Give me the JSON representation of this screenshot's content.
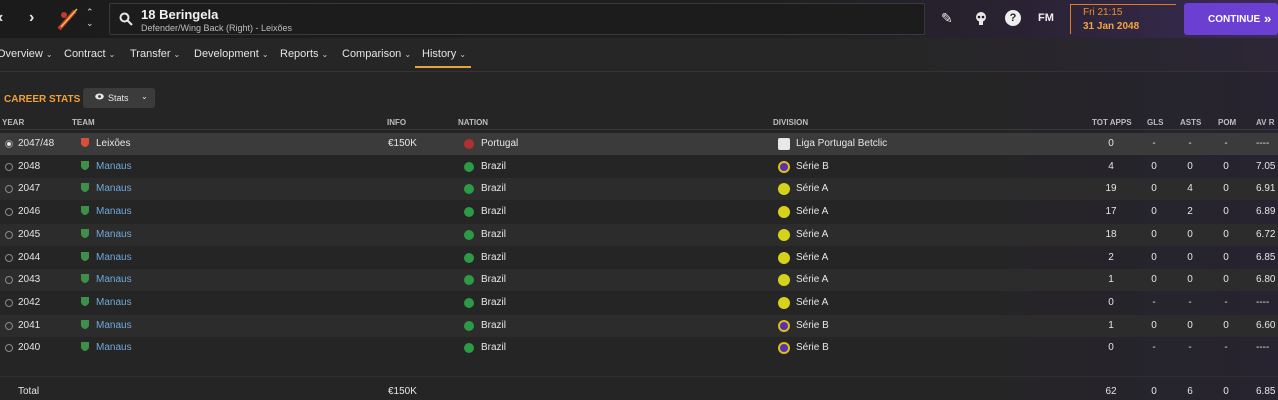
{
  "topbar": {
    "player_name": "18 Beringela",
    "player_subtitle": "Defender/Wing Back (Right) - Leixões",
    "fm_label": "FM",
    "help_label": "?",
    "date_time": "Fri 21:15",
    "date_day": "31 Jan 2048",
    "continue_label": "CONTINUE",
    "continue_arrows": "»"
  },
  "tabs": [
    {
      "label": "Overview"
    },
    {
      "label": "Contract"
    },
    {
      "label": "Transfer"
    },
    {
      "label": "Development"
    },
    {
      "label": "Reports"
    },
    {
      "label": "Comparison"
    },
    {
      "label": "History",
      "active": true
    }
  ],
  "section": {
    "title": "CAREER STATS",
    "stats_button": "Stats"
  },
  "columns": {
    "year": "YEAR",
    "team": "TEAM",
    "info": "INFO",
    "nation": "NATION",
    "division": "DIVISION",
    "tot_apps": "TOT APPS",
    "gls": "GLS",
    "asts": "ASTS",
    "pom": "POM",
    "av_r": "AV R"
  },
  "rows": [
    {
      "year": "2047/48",
      "team": "Leixões",
      "info": "€150K",
      "nation": "Portugal",
      "division": "Liga Portugal Betclic",
      "apps": "0",
      "gls": "-",
      "asts": "-",
      "pom": "-",
      "avr": "----"
    },
    {
      "year": "2048",
      "team": "Manaus",
      "info": "",
      "nation": "Brazil",
      "division": "Série B",
      "apps": "4",
      "gls": "0",
      "asts": "0",
      "pom": "0",
      "avr": "7.05"
    },
    {
      "year": "2047",
      "team": "Manaus",
      "info": "",
      "nation": "Brazil",
      "division": "Série A",
      "apps": "19",
      "gls": "0",
      "asts": "4",
      "pom": "0",
      "avr": "6.91"
    },
    {
      "year": "2046",
      "team": "Manaus",
      "info": "",
      "nation": "Brazil",
      "division": "Série A",
      "apps": "17",
      "gls": "0",
      "asts": "2",
      "pom": "0",
      "avr": "6.89"
    },
    {
      "year": "2045",
      "team": "Manaus",
      "info": "",
      "nation": "Brazil",
      "division": "Série A",
      "apps": "18",
      "gls": "0",
      "asts": "0",
      "pom": "0",
      "avr": "6.72"
    },
    {
      "year": "2044",
      "team": "Manaus",
      "info": "",
      "nation": "Brazil",
      "division": "Série A",
      "apps": "2",
      "gls": "0",
      "asts": "0",
      "pom": "0",
      "avr": "6.85"
    },
    {
      "year": "2043",
      "team": "Manaus",
      "info": "",
      "nation": "Brazil",
      "division": "Série A",
      "apps": "1",
      "gls": "0",
      "asts": "0",
      "pom": "0",
      "avr": "6.80"
    },
    {
      "year": "2042",
      "team": "Manaus",
      "info": "",
      "nation": "Brazil",
      "division": "Série A",
      "apps": "0",
      "gls": "-",
      "asts": "-",
      "pom": "-",
      "avr": "----"
    },
    {
      "year": "2041",
      "team": "Manaus",
      "info": "",
      "nation": "Brazil",
      "division": "Série B",
      "apps": "1",
      "gls": "0",
      "asts": "0",
      "pom": "0",
      "avr": "6.60"
    },
    {
      "year": "2040",
      "team": "Manaus",
      "info": "",
      "nation": "Brazil",
      "division": "Série B",
      "apps": "0",
      "gls": "-",
      "asts": "-",
      "pom": "-",
      "avr": "----"
    }
  ],
  "total": {
    "label": "Total",
    "info": "€150K",
    "apps": "62",
    "gls": "0",
    "asts": "6",
    "pom": "0",
    "avr": "6.85"
  },
  "colors": {
    "accent_orange": "#f0a13a",
    "continue_purple": "#6b3fd1",
    "link_blue": "#6fa8dc",
    "serie_a_yellow": "#d6d21a",
    "serie_b_purple": "#5a2fb0"
  }
}
